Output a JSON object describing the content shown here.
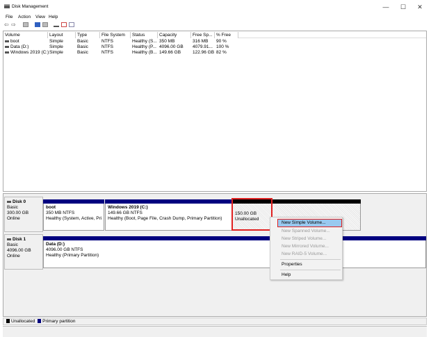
{
  "window": {
    "title": "Disk Management",
    "minimize": "—",
    "maximize": "☐",
    "close": "✕"
  },
  "menu": [
    "File",
    "Action",
    "View",
    "Help"
  ],
  "columns": [
    "Volume",
    "Layout",
    "Type",
    "File System",
    "Status",
    "Capacity",
    "Free Sp...",
    "% Free"
  ],
  "volumes": [
    {
      "volume": "boot",
      "layout": "Simple",
      "type": "Basic",
      "fs": "NTFS",
      "status": "Healthy (S...",
      "capacity": "350 MB",
      "free": "316 MB",
      "pct": "90 %"
    },
    {
      "volume": "Data (D:)",
      "layout": "Simple",
      "type": "Basic",
      "fs": "NTFS",
      "status": "Healthy (P...",
      "capacity": "4096.00 GB",
      "free": "4079.91...",
      "pct": "100 %"
    },
    {
      "volume": "Windows 2019 (C:)",
      "layout": "Simple",
      "type": "Basic",
      "fs": "NTFS",
      "status": "Healthy (B...",
      "capacity": "149.66 GB",
      "free": "122.96 GB",
      "pct": "82 %"
    }
  ],
  "disks": [
    {
      "name": "Disk 0",
      "type": "Basic",
      "size": "300.00 GB",
      "state": "Online",
      "partitions": [
        {
          "name": "boot",
          "size": "350 MB NTFS",
          "status": "Healthy (System, Active, Prima"
        },
        {
          "name": "Windows 2019  (C:)",
          "size": "149.66 GB NTFS",
          "status": "Healthy (Boot, Page File, Crash Dump, Primary Partition)"
        },
        {
          "size": "150.00 GB",
          "status": "Unallocated"
        }
      ]
    },
    {
      "name": "Disk 1",
      "type": "Basic",
      "size": "4096.00 GB",
      "state": "Online",
      "partitions": [
        {
          "name": "Data  (D:)",
          "size": "4096.00 GB NTFS",
          "status": "Healthy (Primary Partition)"
        }
      ]
    }
  ],
  "context_menu": [
    "New Simple Volume...",
    "New Spanned Volume...",
    "New Striped Volume...",
    "New Mirrored Volume...",
    "New RAID-5 Volume...",
    "Properties",
    "Help"
  ],
  "legend": [
    "Unallocated",
    "Primary partition"
  ],
  "colors": {
    "primary": "#00007f",
    "unallocated": "#000000",
    "highlight": "#99c9ef",
    "annotation": "#e02020"
  }
}
